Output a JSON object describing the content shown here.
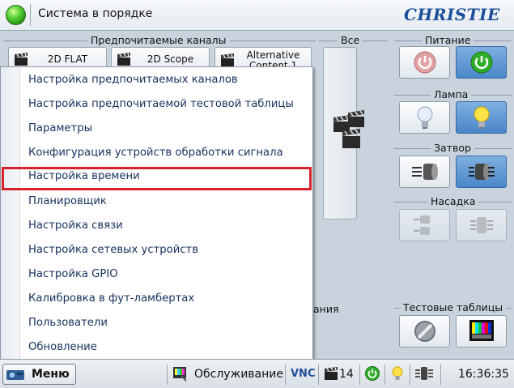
{
  "header": {
    "status": "Система в порядке",
    "logo": "CHRISTIE"
  },
  "sections": {
    "preferred": "Предпочитаемые каналы",
    "all": "Все",
    "power": "Питание",
    "lamp": "Лампа",
    "shutter": "Затвор",
    "lens": "Насадка",
    "test": "Тестовые таблицы"
  },
  "channels": [
    "2D FLAT",
    "2D Scope",
    "Alternative\nContent 1"
  ],
  "menu": {
    "items": [
      "Настройка предпочитаемых каналов",
      "Настройка предпочитаемой тестовой таблицы",
      "Параметры",
      "Конфигурация устройств обработки сигнала",
      "Настройка времени",
      "Планировщик",
      "Настройка связи",
      "Настройка сетевых устройств",
      "Настройка GPIO",
      "Калибровка в фут-ламбертах",
      "Пользователи",
      "Обновление"
    ],
    "highlighted_index": 4
  },
  "partial_text": "ания",
  "taskbar": {
    "menu_label": "Меню",
    "service": "Обслуживание",
    "vnc": "VNC",
    "channel_count": "14",
    "time": "16:36:35"
  },
  "colors": {
    "highlight": "#d8202a",
    "active_button": "#4a86c8",
    "menu_text": "#16315e"
  }
}
